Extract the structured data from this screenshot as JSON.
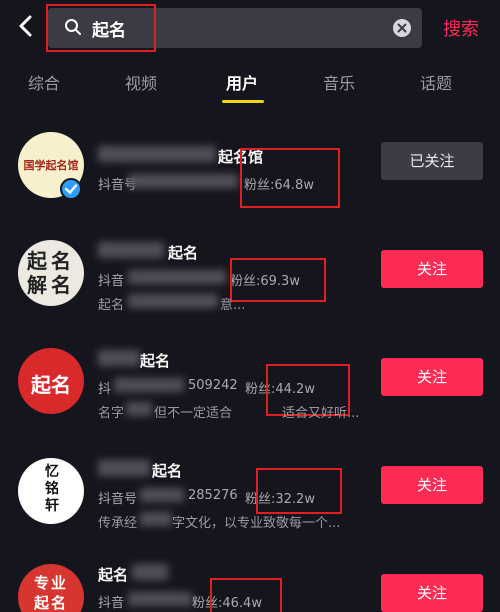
{
  "search": {
    "query": "起名",
    "submit_label": "搜索"
  },
  "tabs": [
    "综合",
    "视频",
    "用户",
    "音乐",
    "话题"
  ],
  "accent": {
    "follow": "#fe2c55",
    "tab_indicator": "#f2d40e",
    "highlight": "#e02020"
  },
  "results": [
    {
      "avatar_text": "国学起名馆",
      "name_visible": "起名馆",
      "meta_prefix": "抖音号",
      "fans": "粉丝:64.8w",
      "desc": "",
      "button": "已关注"
    },
    {
      "avatar_text": "起名解名",
      "name_visible": "起名",
      "meta_prefix": "抖音",
      "fans": "粉丝:69.3w",
      "desc": "起名",
      "desc_tail": "意...",
      "button": "关注"
    },
    {
      "avatar_text": "起名",
      "name_visible": "起名",
      "meta_prefix": "抖",
      "meta_id": "509242",
      "fans": "粉丝:44.2w",
      "desc": "名字",
      "desc_mid": "但不一定适合",
      "desc_tail": "适合又好听...",
      "button": "关注"
    },
    {
      "avatar_text": "忆铭轩",
      "name_visible": "起名",
      "meta_prefix": "抖音号",
      "meta_id": "285276",
      "fans": "粉丝:32.2w",
      "desc": "传承经",
      "desc_tail": "字文化，以专业致敬每一个...",
      "button": "关注"
    },
    {
      "avatar_text": "专业起名",
      "name_visible": "起名",
      "meta_prefix": "抖音",
      "fans": "粉丝:46.4w",
      "desc": "",
      "button": "关注"
    }
  ]
}
